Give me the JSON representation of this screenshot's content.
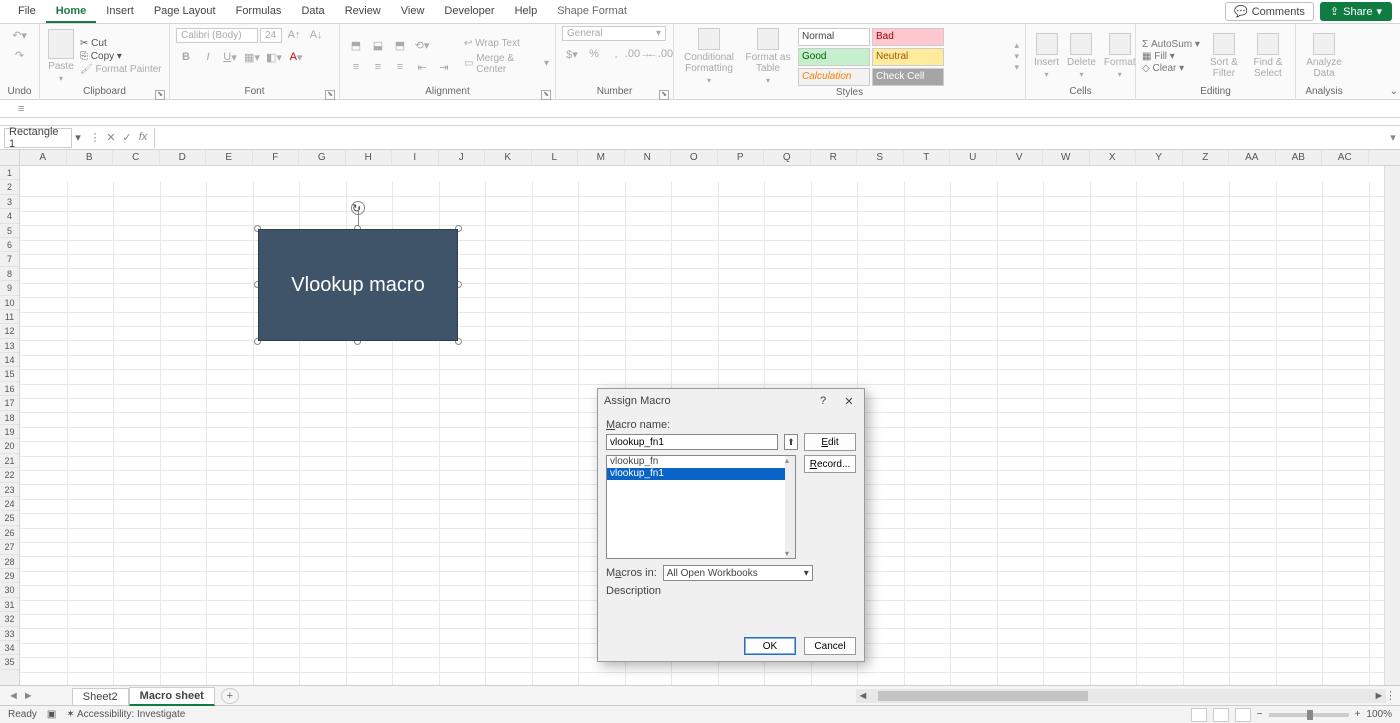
{
  "tabs": {
    "file": "File",
    "home": "Home",
    "insert": "Insert",
    "pagelayout": "Page Layout",
    "formulas": "Formulas",
    "data": "Data",
    "review": "Review",
    "view": "View",
    "developer": "Developer",
    "help": "Help",
    "shapeformat": "Shape Format"
  },
  "topright": {
    "comments": "Comments",
    "share": "Share"
  },
  "groups": {
    "undo": "Undo",
    "clipboard": "Clipboard",
    "font": "Font",
    "alignment": "Alignment",
    "number": "Number",
    "styles": "Styles",
    "cells": "Cells",
    "editing": "Editing",
    "analysis": "Analysis"
  },
  "clipboard": {
    "paste": "Paste",
    "cut": "Cut",
    "copy": "Copy",
    "fp": "Format Painter"
  },
  "font": {
    "name": "Calibri (Body)",
    "size": "24"
  },
  "align": {
    "wrap": "Wrap Text",
    "merge": "Merge & Center"
  },
  "number": {
    "format": "General"
  },
  "styles": {
    "normal": "Normal",
    "bad": "Bad",
    "good": "Good",
    "neutral": "Neutral",
    "calc": "Calculation",
    "check": "Check Cell",
    "cf": "Conditional Formatting",
    "fat": "Format as Table"
  },
  "cells": {
    "insert": "Insert",
    "delete": "Delete",
    "format": "Format"
  },
  "editing": {
    "autosum": "AutoSum",
    "fill": "Fill",
    "clear": "Clear",
    "sort": "Sort & Filter",
    "find": "Find & Select"
  },
  "analysis": {
    "analyze": "Analyze Data"
  },
  "namebox": "Rectangle 1",
  "columns": [
    "A",
    "B",
    "C",
    "D",
    "E",
    "F",
    "G",
    "H",
    "I",
    "J",
    "K",
    "L",
    "M",
    "N",
    "O",
    "P",
    "Q",
    "R",
    "S",
    "T",
    "U",
    "V",
    "W",
    "X",
    "Y",
    "Z",
    "AA",
    "AB",
    "AC"
  ],
  "shape_text": "Vlookup macro",
  "dialog": {
    "title": "Assign Macro",
    "macro_name_label": "Macro name:",
    "macro_name_value": "vlookup_fn1",
    "edit": "Edit",
    "record": "Record...",
    "list": [
      "vlookup_fn",
      "vlookup_fn1"
    ],
    "selected_index": 1,
    "macros_in_label": "Macros in:",
    "macros_in_value": "All Open Workbooks",
    "description_label": "Description",
    "ok": "OK",
    "cancel": "Cancel"
  },
  "sheets": {
    "nav_prev": "◄",
    "nav_next": "►",
    "s1": "Sheet2",
    "s2": "Macro sheet"
  },
  "status": {
    "ready": "Ready",
    "acc": "Accessibility: Investigate",
    "zoom": "100%"
  }
}
